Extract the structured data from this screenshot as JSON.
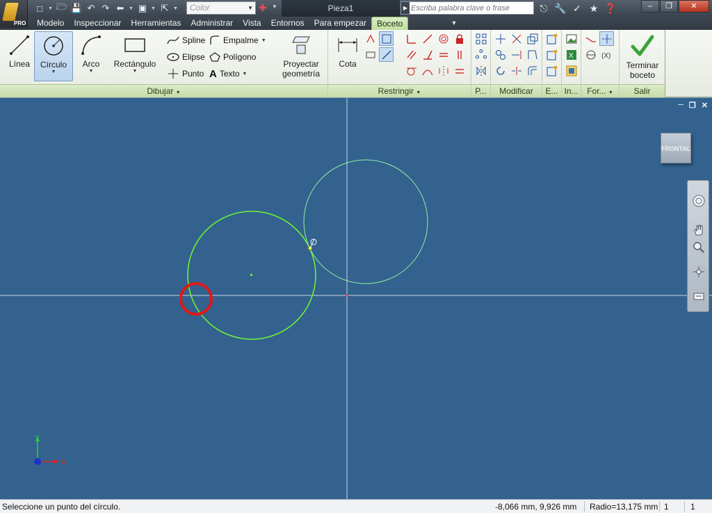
{
  "app": {
    "pro_badge": "PRO"
  },
  "toolbar": {
    "color_combo": "Color"
  },
  "document": {
    "title": "Pieza1"
  },
  "search": {
    "placeholder": "Escriba palabra clave o frase"
  },
  "tabs": [
    {
      "label": "Modelo"
    },
    {
      "label": "Inspeccionar"
    },
    {
      "label": "Herramientas"
    },
    {
      "label": "Administrar"
    },
    {
      "label": "Vista"
    },
    {
      "label": "Entornos"
    },
    {
      "label": "Para empezar"
    },
    {
      "label": "Boceto",
      "active": true
    }
  ],
  "ribbon": {
    "draw": {
      "label": "Dibujar",
      "line": "Línea",
      "circle": "Círculo",
      "arc": "Arco",
      "rectangle": "Rectángulo",
      "spline": "Spline",
      "ellipse": "Elipse",
      "point": "Punto",
      "fillet": "Empalme",
      "polygon": "Polígono",
      "text": "Texto",
      "project_line1": "Proyectar",
      "project_line2": "geometría"
    },
    "constrain": {
      "label": "Restringir",
      "dimension": "Cota"
    },
    "pattern": {
      "label": "P..."
    },
    "modify": {
      "label": "Modificar"
    },
    "insert_e": {
      "label": "E..."
    },
    "insert": {
      "label": "In..."
    },
    "format": {
      "label": "For..."
    },
    "exit": {
      "label": "Salir",
      "finish_line1": "Terminar",
      "finish_line2": "boceto"
    }
  },
  "viewport": {
    "viewcube_label": "FRONTAL",
    "axis_x": "X",
    "axis_y": "Y"
  },
  "status": {
    "message": "Seleccione un punto del círculo.",
    "coords": "-8,066 mm, 9,926 mm",
    "radius": "Radio=13,175 mm",
    "count1": "1",
    "count2": "1"
  },
  "colors": {
    "viewport_bg": "#33628f",
    "sketch_green": "#6cf233",
    "preview_green": "#8cf0a0",
    "highlight_red": "#e01818",
    "ribbon_green": "#c6dca9"
  }
}
